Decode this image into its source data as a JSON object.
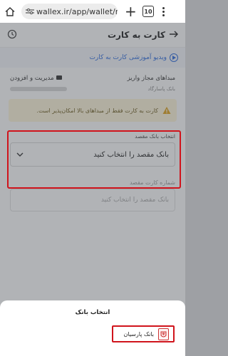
{
  "browser": {
    "url": "wallex.ir/app/wallet/mo",
    "tab_count": "10"
  },
  "header": {
    "title": "کارت به کارت"
  },
  "video_link": "ویدیو آموزشی کارت به کارت",
  "sources": {
    "label": "مبداهای مجاز واریز",
    "manage_label": "مدیریت و افزودن",
    "bank_name": "بانک پاسارگاد"
  },
  "notice": "کارت به کارت فقط از مبداهای بالا امکان‌پذیر است.",
  "destination_bank": {
    "label": "انتخاب بانک مقصد",
    "placeholder": "بانک مقصد را انتخاب کنید"
  },
  "destination_card": {
    "label": "شماره کارت مقصد",
    "placeholder": "بانک مقصد را انتخاب کنید"
  },
  "bank_sheet": {
    "title": "انتخاب بانک",
    "option": "بانک پارسیان"
  },
  "colors": {
    "accent_blue": "#2d6cdf",
    "highlight_red": "#d0141c",
    "notice_bg": "#fff6db"
  }
}
